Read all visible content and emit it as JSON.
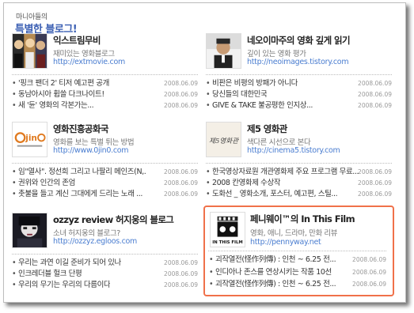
{
  "header": {
    "subtitle": "마니아들의",
    "title": "특별한 블로그!"
  },
  "accent_color": "#f0714a",
  "link_color": "#4a7dd0",
  "title_color": "#3b5fb3",
  "blogs": [
    {
      "name": "익스트림무비",
      "desc": "재미있는 영화블로그",
      "url": "http://extmovie.com",
      "thumb_icon": "movie-poster-thumbnail",
      "posts": [
        {
          "title": "'핑크 팬더 2' 티저 예고편 공개",
          "date": "2008.06.09"
        },
        {
          "title": "동남아시아 휩쓸 다크나이트!",
          "date": "2008.06.09"
        },
        {
          "title": "새 '듄' 영화의 각본가는...",
          "date": "2008.06.09"
        }
      ]
    },
    {
      "name": "네오이마주의 영화 깊게 읽기",
      "desc": "깊이 있는 영화 평가",
      "url": "http://neoimages.tistory.com",
      "thumb_icon": "portrait-thumbnail",
      "posts": [
        {
          "title": "비판은 비평의 방패가 아니다",
          "date": "2008.06.09"
        },
        {
          "title": "당신들의 대한민국",
          "date": "2008.06.09"
        },
        {
          "title": "GIVE & TAKE 불공평한 인지상...",
          "date": "2008.06.09"
        }
      ]
    },
    {
      "name": "영화진흥공화국",
      "desc": "영화를 보는 특별 튀는 방법",
      "url": "http://www.0jin0.com",
      "thumb_icon": "0jin0-logo",
      "logo_text": "0jin0",
      "posts": [
        {
          "title": "임\"열사\". 정선희 그리고 나팔리 메인즈(N,.",
          "date": "2008.06.09"
        },
        {
          "title": "권위와 인간의 존엄",
          "date": "2008.06.09"
        },
        {
          "title": "촛불을 들고 계신 그대에게 드리는 노래 ...",
          "date": "2008.06.09"
        }
      ]
    },
    {
      "name": "제5 영화관",
      "desc": "색다른 시선으로 본다",
      "url": "http://cinema5.tistory.com",
      "thumb_icon": "cinema5-logo",
      "logo_text": "제5영화관",
      "posts": [
        {
          "title": "한국영상자료원 개관영화제 주요 프로그램 무료...",
          "date": "2008.06.09"
        },
        {
          "title": "2008 칸영화제 수상작",
          "date": "2008.06.09"
        },
        {
          "title": "도화선 _ 영화소개, 포스터, 예고편, 스틸...",
          "date": "2008.06.09"
        }
      ]
    },
    {
      "name": "ozzyz review 허지웅의 블로그",
      "desc": "소녀 허지웅의 블로그?",
      "url": "http://ozzyz.egloos.com",
      "thumb_icon": "face-photo-thumbnail",
      "posts": [
        {
          "title": "우리는 과연 이길 준비가 되어 있나",
          "date": "2008.06.09"
        },
        {
          "title": "인크레더블 헐크 단평",
          "date": "2008.06.09"
        },
        {
          "title": "우리의 무기는 우리의 다름이다",
          "date": "2008.06.09"
        }
      ]
    },
    {
      "name": "페니웨이™의 In This Film",
      "desc": "영화, 애니, 드라마, 만화 리뷰",
      "url": "http://pennyway.net",
      "thumb_icon": "in-this-film-logo",
      "logo_text": "IN THIS FILM",
      "posts": [
        {
          "title": "괴작열전(怪作列傳) : 인천 ~ 6.25 전...",
          "date": "2008.06.09"
        },
        {
          "title": "인디아나 존스를 연상시키는 작품 10선",
          "date": "2008.06.09"
        },
        {
          "title": "괴작열전(怪作列傳) : 인천 ~ 6.25 전...",
          "date": "2008.06.09"
        }
      ]
    }
  ]
}
